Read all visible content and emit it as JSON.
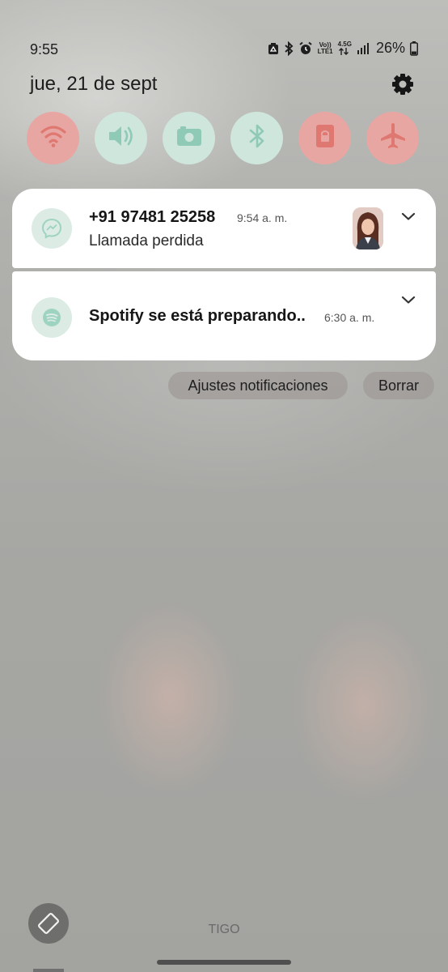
{
  "status_bar": {
    "time": "9:55",
    "icons": [
      "recycle-icon",
      "bluetooth-icon",
      "alarm-icon",
      "volte-icon",
      "data-arrows-icon",
      "signal-icon",
      "battery-icon"
    ],
    "volte_label_top": "Vo))",
    "volte_label_bottom": "LTE1",
    "network_label": "4.5G",
    "battery_percent": "26%"
  },
  "header": {
    "date": "jue, 21 de sept",
    "settings_icon": "gear-icon"
  },
  "quick_settings": [
    {
      "name": "wifi",
      "icon": "wifi-icon",
      "state": "off",
      "color": "#e8a6a2"
    },
    {
      "name": "sound",
      "icon": "speaker-icon",
      "state": "on",
      "color": "#cfe6dd"
    },
    {
      "name": "screenshot",
      "icon": "camera-icon",
      "state": "on",
      "color": "#cfe6dd"
    },
    {
      "name": "bluetooth",
      "icon": "bluetooth-icon",
      "state": "on",
      "color": "#cfe6dd"
    },
    {
      "name": "rotation-lock",
      "icon": "lock-icon",
      "state": "off",
      "color": "#e8a6a2"
    },
    {
      "name": "airplane",
      "icon": "airplane-icon",
      "state": "off",
      "color": "#e8a6a2"
    }
  ],
  "notifications": [
    {
      "app_icon": "messenger-icon",
      "title": "+91 97481 25258",
      "time": "9:54 a. m.",
      "body": "Llamada perdida",
      "has_avatar": true
    },
    {
      "app_icon": "spotify-icon",
      "title": "Spotify se está preparando..",
      "time": "6:30 a. m."
    }
  ],
  "actions": {
    "settings_label": "Ajustes notificaciones",
    "clear_label": "Borrar"
  },
  "footer": {
    "carrier": "TIGO",
    "rotate_icon": "rotate-screen-icon"
  },
  "colors": {
    "qs_off": "#e8a6a2",
    "qs_on": "#cfe6dd",
    "app_icon_bg": "#dcece5",
    "card_bg": "#ffffff"
  }
}
